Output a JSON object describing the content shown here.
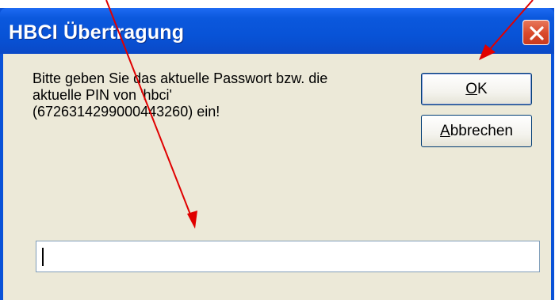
{
  "dialog": {
    "title": "HBCI Übertragung",
    "message": "Bitte geben Sie das aktuelle Passwort bzw. die\naktuelle PIN von 'hbci'\n(6726314299000443260) ein!",
    "ok_mnemonic": "O",
    "ok_rest": "K",
    "cancel_mnemonic": "A",
    "cancel_rest": "bbrechen",
    "password_value": ""
  },
  "colors": {
    "titlebar": "#0a53d8",
    "client_bg": "#ece9d8",
    "annotation_arrow": "#e00000"
  },
  "icons": {
    "close": "close-icon"
  }
}
